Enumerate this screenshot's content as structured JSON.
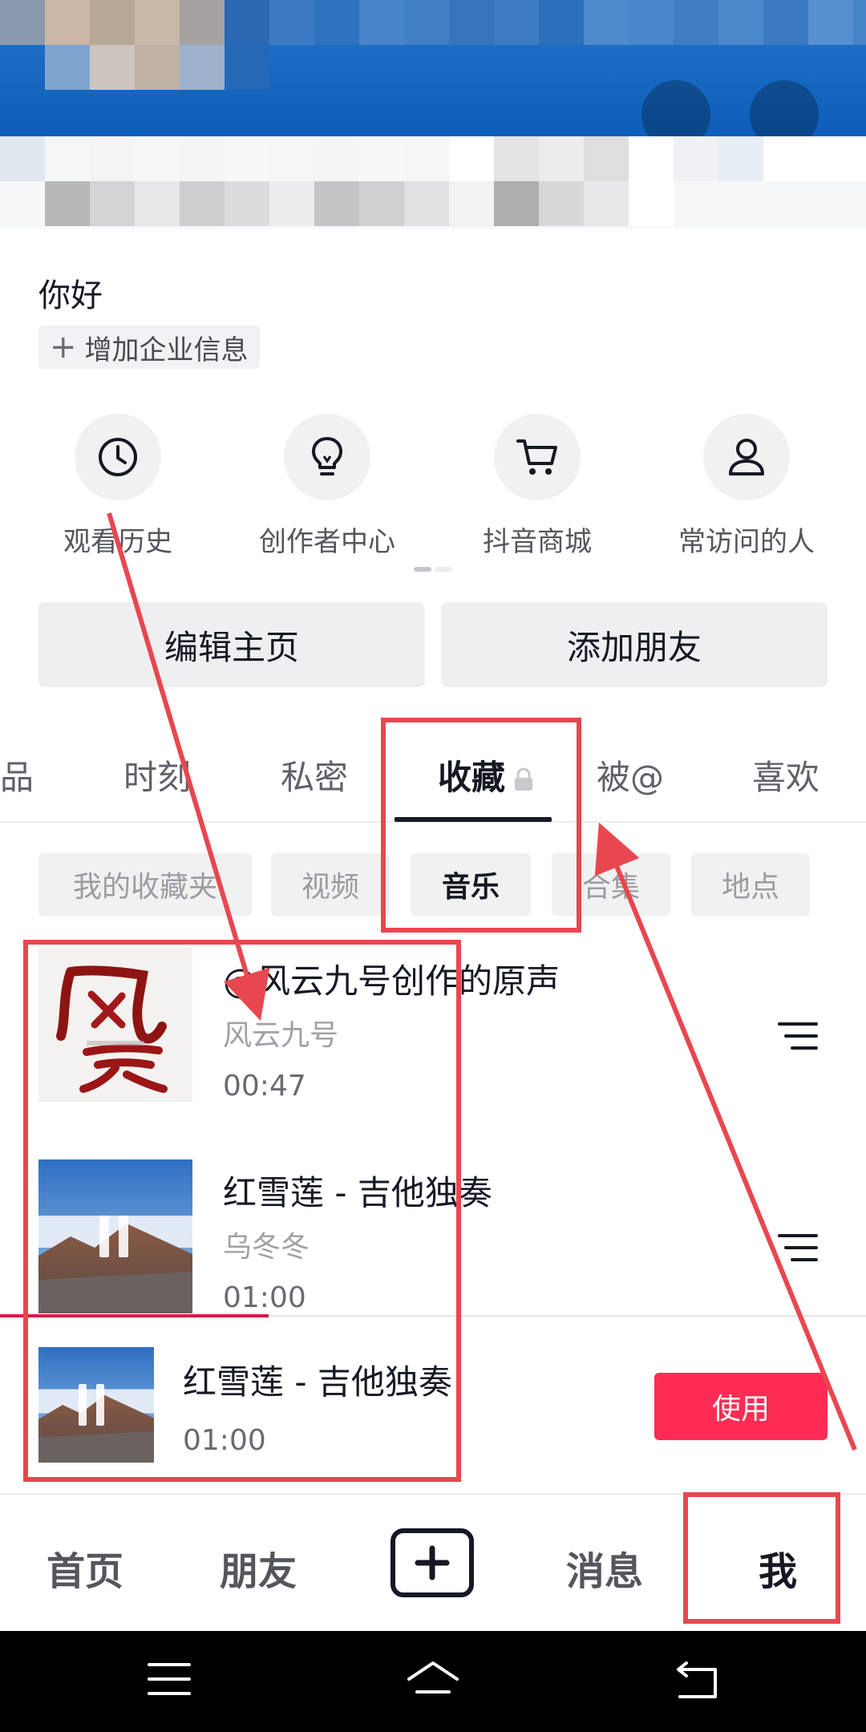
{
  "header": {
    "title": "",
    "colors": {
      "banner": "#1a6cc4",
      "banner_dark": "#0c5eb8"
    }
  },
  "profile": {
    "greeting": "你好",
    "add_company_label": "增加企业信息"
  },
  "quick_access": [
    {
      "label": "观看历史",
      "icon": "clock-icon"
    },
    {
      "label": "创作者中心",
      "icon": "lightbulb-icon"
    },
    {
      "label": "抖音商城",
      "icon": "cart-icon"
    },
    {
      "label": "常访问的人",
      "icon": "person-icon"
    }
  ],
  "actions": {
    "edit_profile": "编辑主页",
    "add_friends": "添加朋友"
  },
  "tabs": [
    {
      "label": "品"
    },
    {
      "label": "时刻"
    },
    {
      "label": "私密"
    },
    {
      "label": "收藏",
      "active": true,
      "icon": "lock-icon"
    },
    {
      "label": "被@"
    },
    {
      "label": "喜欢"
    }
  ],
  "filters": [
    {
      "label": "我的收藏夹"
    },
    {
      "label": "视频"
    },
    {
      "label": "音乐",
      "active": true
    },
    {
      "label": "合集"
    },
    {
      "label": "地点"
    }
  ],
  "tracks": [
    {
      "title": "@风云九号创作的原声",
      "artist": "风云九号",
      "duration": "00:47",
      "cover": "calligraphy-cover"
    },
    {
      "title": "红雪莲 - 吉他独奏",
      "artist": "乌冬冬",
      "duration": "01:00",
      "cover": "mountain-cover"
    }
  ],
  "now_playing": {
    "title": "红雪莲 - 吉他独奏",
    "duration": "01:00",
    "use_label": "使用",
    "progress": 0.31
  },
  "bottom_nav": {
    "home": "首页",
    "friends": "朋友",
    "messages": "消息",
    "me": "我"
  },
  "colors": {
    "accent": "#fe2c55",
    "annotation": "#e8474f",
    "text": "#161823"
  }
}
